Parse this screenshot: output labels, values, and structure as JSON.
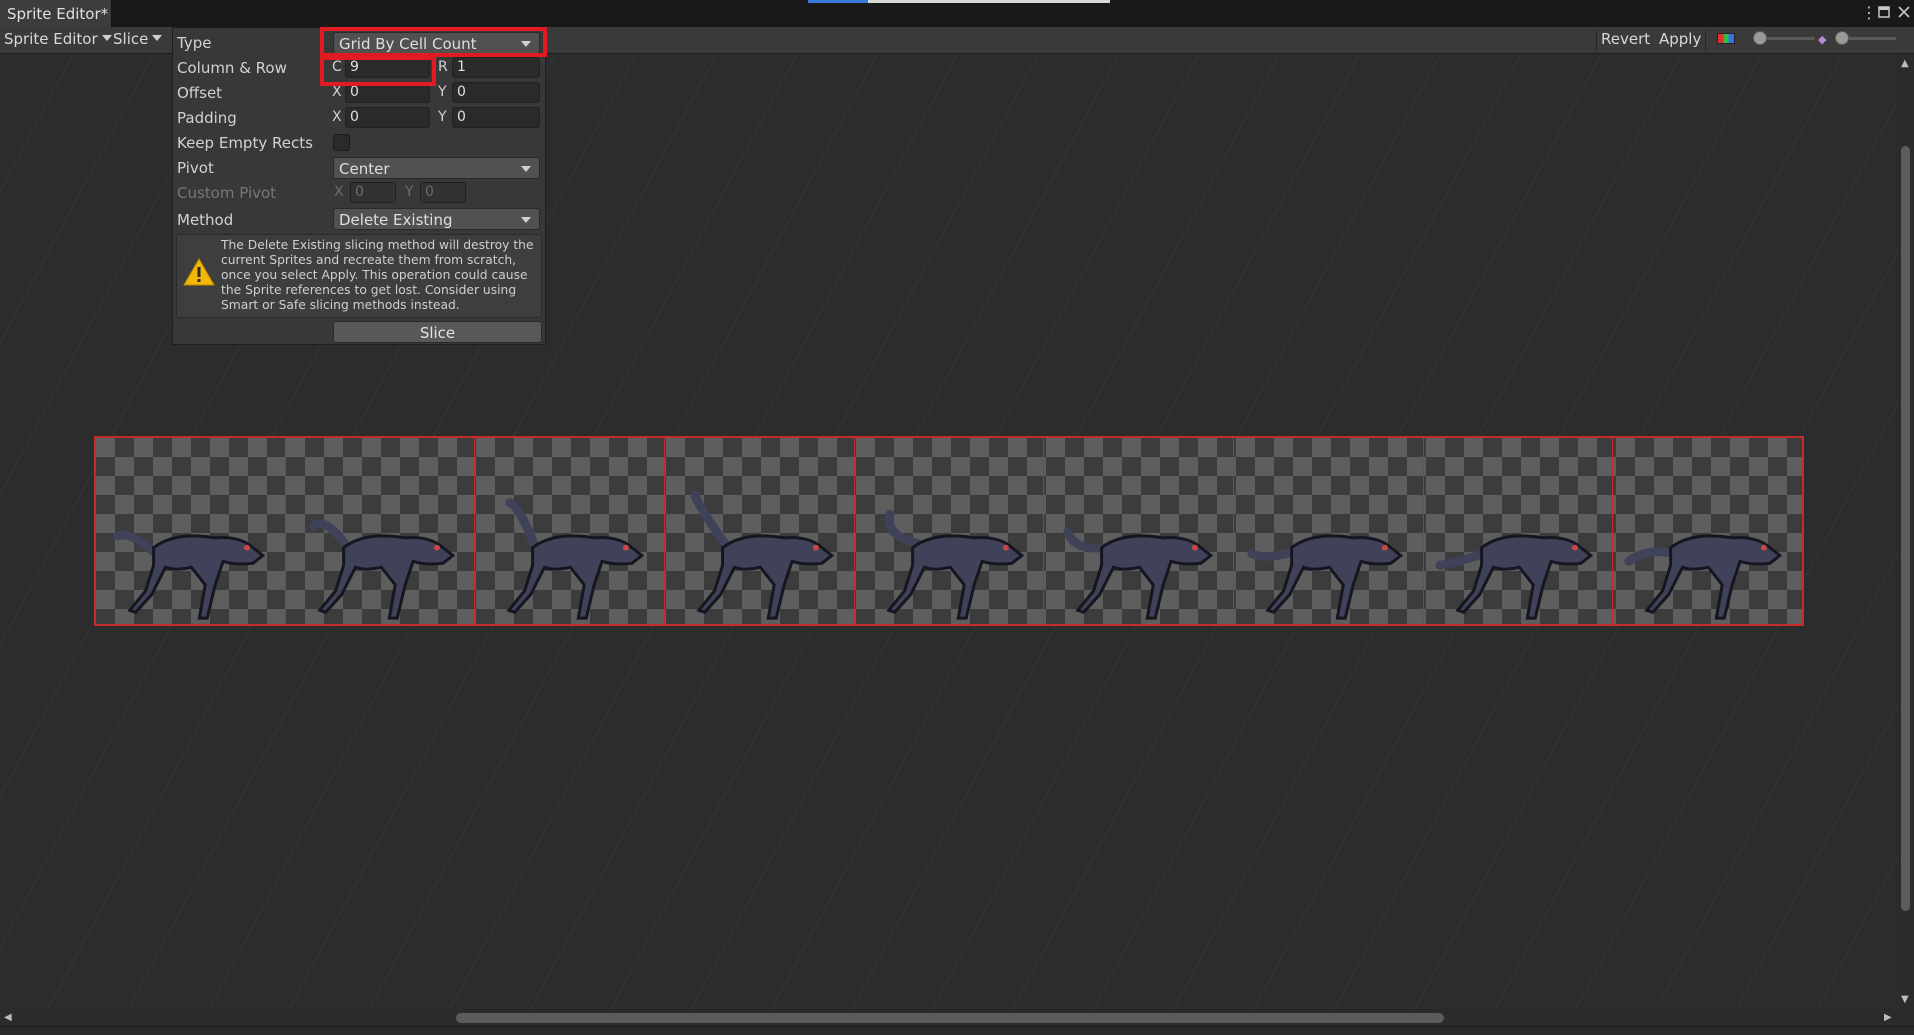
{
  "window": {
    "tab_title": "Sprite Editor*",
    "menu_icon": "kebab-menu-icon",
    "maximize_icon": "maximize-icon",
    "close_icon": "close-icon"
  },
  "toolbar": {
    "editor_mode": "Sprite Editor",
    "slice_menu": "Slice",
    "revert": "Revert",
    "apply": "Apply",
    "color_channel_icon": "color-channel-icon",
    "zoom_slider_icon": "zoom-slider-icon",
    "mip_slider_icon": "mip-level-icon"
  },
  "slice_panel": {
    "type_label": "Type",
    "type_value": "Grid By Cell Count",
    "colrow_label": "Column & Row",
    "col_axis": "C",
    "col_value": "9",
    "row_axis": "R",
    "row_value": "1",
    "offset_label": "Offset",
    "offset_x_axis": "X",
    "offset_x": "0",
    "offset_y_axis": "Y",
    "offset_y": "0",
    "padding_label": "Padding",
    "padding_x_axis": "X",
    "padding_x": "0",
    "padding_y_axis": "Y",
    "padding_y": "0",
    "keep_empty_label": "Keep Empty Rects",
    "keep_empty_checked": false,
    "pivot_label": "Pivot",
    "pivot_value": "Center",
    "custom_pivot_label": "Custom Pivot",
    "custom_pivot_x_axis": "X",
    "custom_pivot_x": "0",
    "custom_pivot_y_axis": "Y",
    "custom_pivot_y": "0",
    "method_label": "Method",
    "method_value": "Delete Existing",
    "warning_icon": "warning-icon",
    "warning_text": "The Delete Existing slicing method will destroy the current Sprites and recreate them from scratch, once you select Apply. This operation could cause the Sprite references to get lost. Consider using Smart or Safe slicing methods instead.",
    "slice_button": "Slice"
  },
  "sprite_sheet": {
    "columns": 9,
    "rows": 1,
    "frame_icon": "wolf-run-frame"
  },
  "colors": {
    "highlight": "#e11b24",
    "slice_line": "#c82a2a",
    "panel": "#383838",
    "background": "#2c2c2c"
  }
}
